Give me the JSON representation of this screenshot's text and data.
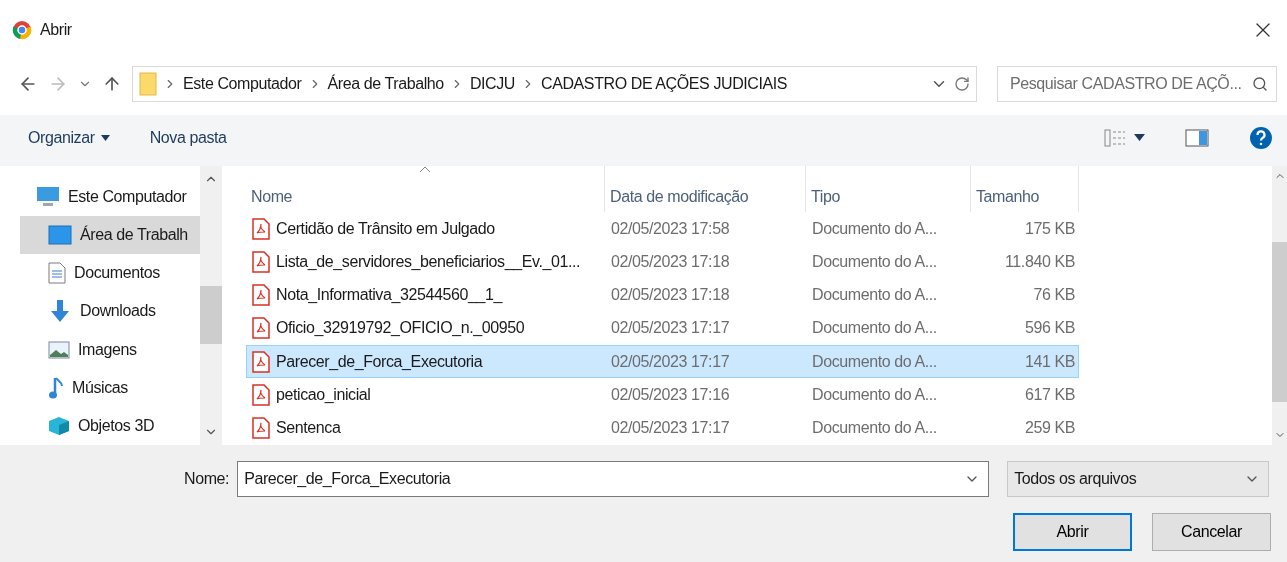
{
  "window": {
    "title": "Abrir"
  },
  "address": {
    "segments": [
      "Este Computador",
      "Área de Trabalho",
      "DICJU",
      "CADASTRO DE AÇÕES JUDICIAIS"
    ]
  },
  "search": {
    "placeholder": "Pesquisar CADASTRO DE AÇÕ..."
  },
  "toolbar": {
    "organize": "Organizar",
    "new_folder": "Nova pasta"
  },
  "sidebar": {
    "items": [
      {
        "label": "Este Computador",
        "kind": "computer",
        "selected": false,
        "children": [
          {
            "label": "Área de Trabalh",
            "kind": "desktop",
            "selected": true
          },
          {
            "label": "Documentos",
            "kind": "documents",
            "selected": false
          },
          {
            "label": "Downloads",
            "kind": "downloads",
            "selected": false
          },
          {
            "label": "Imagens",
            "kind": "pictures",
            "selected": false
          },
          {
            "label": "Músicas",
            "kind": "music",
            "selected": false
          },
          {
            "label": "Objetos 3D",
            "kind": "objects",
            "selected": false
          }
        ]
      }
    ]
  },
  "table": {
    "columns": [
      {
        "label": "Nome",
        "sorted": true
      },
      {
        "label": "Data de modificação",
        "sorted": false
      },
      {
        "label": "Tipo",
        "sorted": false
      },
      {
        "label": "Tamanho",
        "sorted": false
      }
    ],
    "rows": [
      {
        "name": "Certidão de Trânsito em Julgado",
        "date": "02/05/2023 17:58",
        "type": "Documento do A...",
        "size": "175 KB",
        "selected": false
      },
      {
        "name": "Lista_de_servidores_beneficiarios__Ev._01...",
        "date": "02/05/2023 17:18",
        "type": "Documento do A...",
        "size": "11.840 KB",
        "selected": false
      },
      {
        "name": "Nota_Informativa_32544560__1_",
        "date": "02/05/2023 17:18",
        "type": "Documento do A...",
        "size": "76 KB",
        "selected": false
      },
      {
        "name": "Oficio_32919792_OFICIO_n._00950",
        "date": "02/05/2023 17:17",
        "type": "Documento do A...",
        "size": "596 KB",
        "selected": false
      },
      {
        "name": "Parecer_de_Forca_Executoria",
        "date": "02/05/2023 17:17",
        "type": "Documento do A...",
        "size": "141 KB",
        "selected": true
      },
      {
        "name": "peticao_inicial",
        "date": "02/05/2023 17:16",
        "type": "Documento do A...",
        "size": "617 KB",
        "selected": false
      },
      {
        "name": "Sentenca",
        "date": "02/05/2023 17:17",
        "type": "Documento do A...",
        "size": "259 KB",
        "selected": false
      }
    ]
  },
  "footer": {
    "name_label": "Nome:",
    "name_value": "Parecer_de_Forca_Executoria",
    "filter": "Todos os arquivos",
    "buttons": [
      {
        "label": "Abrir",
        "default": true
      },
      {
        "label": "Cancelar",
        "default": false
      }
    ]
  }
}
